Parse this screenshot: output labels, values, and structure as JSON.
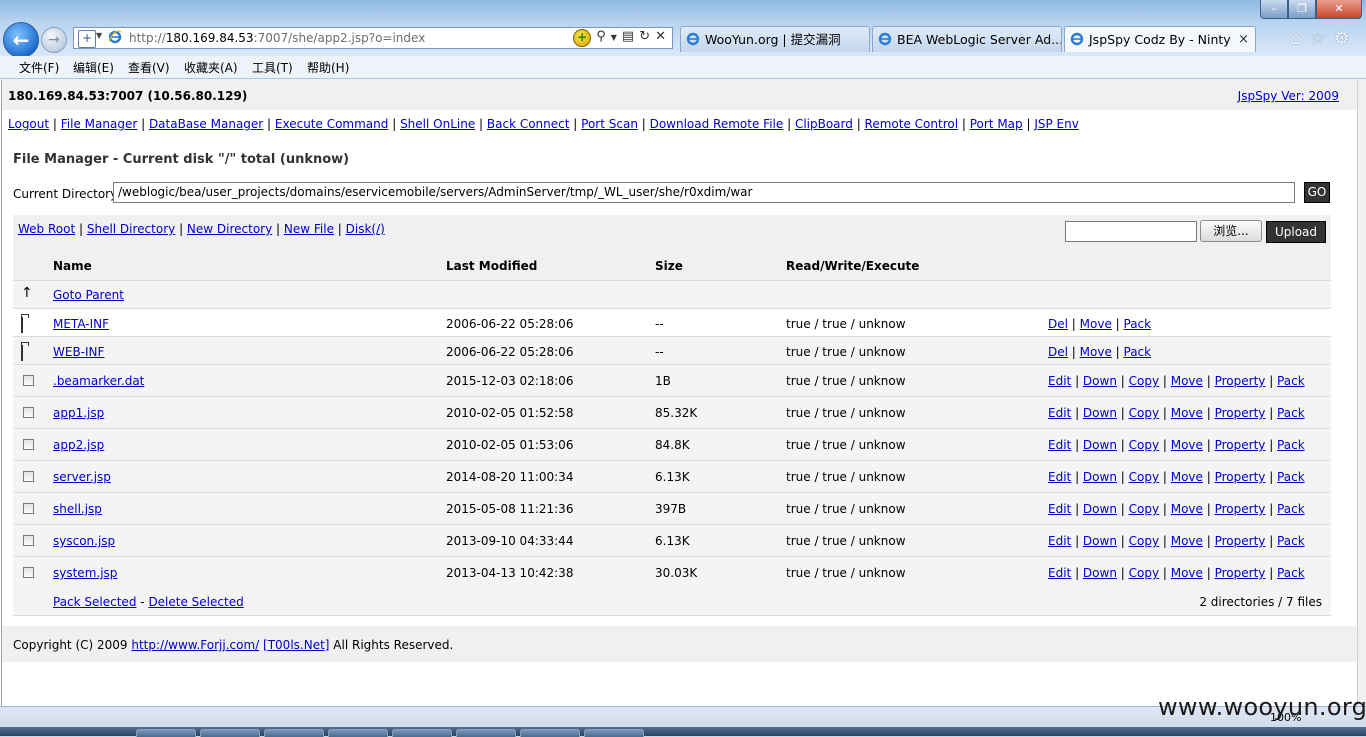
{
  "browser": {
    "address_url_prefix": "http://",
    "address_host": "180.169.84.53",
    "address_url_rest": ":7007/she/app2.jsp?o=index",
    "tabs": [
      {
        "label": "WooYun.org | 提交漏洞"
      },
      {
        "label": "BEA WebLogic Server Ad..."
      },
      {
        "label": "JspSpy Codz By - Ninty",
        "close": "×"
      }
    ],
    "menu": [
      "文件(F)",
      "编辑(E)",
      "查看(V)",
      "收藏夹(A)",
      "工具(T)",
      "帮助(H)"
    ],
    "zoom": "100%"
  },
  "header": {
    "host_info": "180.169.84.53:7007 (10.56.80.129)",
    "version_link": "JspSpy Ver: 2009"
  },
  "nav_links": [
    "Logout",
    "File Manager",
    "DataBase Manager",
    "Execute Command",
    "Shell OnLine",
    "Back Connect",
    "Port Scan",
    "Download Remote File",
    "ClipBoard",
    "Remote Control",
    "Port Map",
    "JSP Env"
  ],
  "file_manager": {
    "title": "File Manager - Current disk \"/\" total (unknow)",
    "current_dir_label": "Current Directory",
    "current_dir_value": "/weblogic/bea/user_projects/domains/eservicemobile/servers/AdminServer/tmp/_WL_user/she/r0xdim/war",
    "go_label": "GO",
    "tool_links": [
      "Web Root",
      "Shell Directory",
      "New Directory",
      "New File",
      "Disk(/)"
    ],
    "browse_label": "浏览...",
    "upload_label": "Upload",
    "columns": {
      "name": "Name",
      "modified": "Last Modified",
      "size": "Size",
      "rwx": "Read/Write/Execute"
    },
    "parent_label": "Goto Parent",
    "parent_icon": "↑",
    "directories": [
      {
        "name": "META-INF",
        "modified": "2006-06-22 05:28:06",
        "size": "--",
        "rwx": "true / true / unknow",
        "actions": [
          "Del",
          "Move",
          "Pack"
        ]
      },
      {
        "name": "WEB-INF",
        "modified": "2006-06-22 05:28:06",
        "size": "--",
        "rwx": "true / true / unknow",
        "actions": [
          "Del",
          "Move",
          "Pack"
        ]
      }
    ],
    "files": [
      {
        "name": ".beamarker.dat",
        "modified": "2015-12-03 02:18:06",
        "size": "1B",
        "rwx": "true / true / unknow"
      },
      {
        "name": "app1.jsp",
        "modified": "2010-02-05 01:52:58",
        "size": "85.32K",
        "rwx": "true / true / unknow"
      },
      {
        "name": "app2.jsp",
        "modified": "2010-02-05 01:53:06",
        "size": "84.8K",
        "rwx": "true / true / unknow"
      },
      {
        "name": "server.jsp",
        "modified": "2014-08-20 11:00:34",
        "size": "6.13K",
        "rwx": "true / true / unknow"
      },
      {
        "name": "shell.jsp",
        "modified": "2015-05-08 11:21:36",
        "size": "397B",
        "rwx": "true / true / unknow"
      },
      {
        "name": "syscon.jsp",
        "modified": "2013-09-10 04:33:44",
        "size": "6.13K",
        "rwx": "true / true / unknow"
      },
      {
        "name": "system.jsp",
        "modified": "2013-04-13 10:42:38",
        "size": "30.03K",
        "rwx": "true / true / unknow"
      }
    ],
    "file_actions": [
      "Edit",
      "Down",
      "Copy",
      "Move",
      "Property",
      "Pack"
    ],
    "pack_selected": "Pack Selected",
    "footer_sep": "-",
    "delete_selected": "Delete Selected",
    "summary": "2 directories / 7 files"
  },
  "footer": {
    "copyright_prefix": "Copyright (C) 2009",
    "link1": "http://www.Forjj.com/",
    "link2": "[T00ls.Net]",
    "suffix": "All Rights Reserved."
  },
  "watermark": "www.wooyun.org"
}
